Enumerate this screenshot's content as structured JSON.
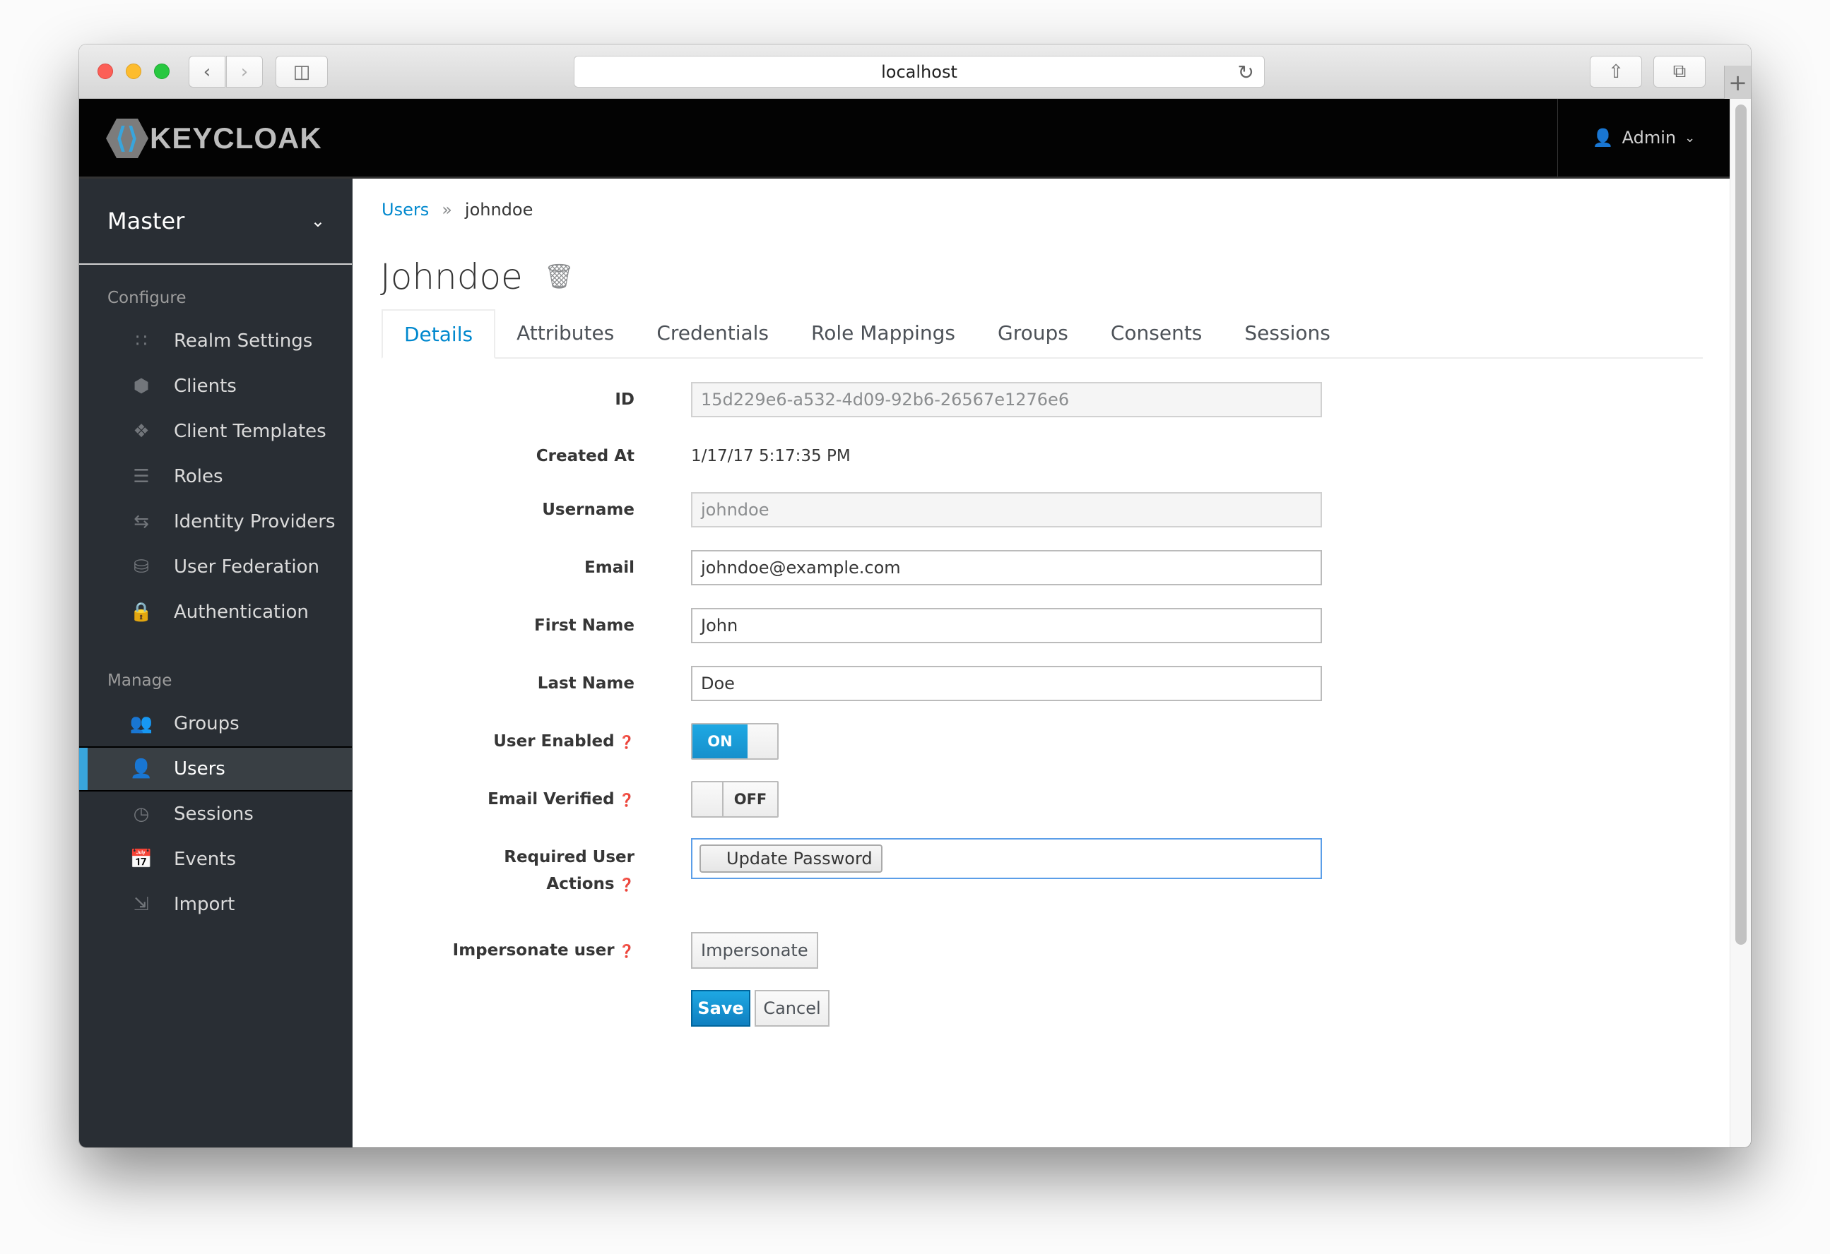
{
  "browser": {
    "url": "localhost",
    "back_icon": "chevron-left-icon",
    "forward_icon": "chevron-right-icon",
    "sidebar_icon": "sidebar-toggle-icon",
    "reload_icon": "reload-icon",
    "share_icon": "share-icon",
    "tabs_icon": "tab-overview-icon",
    "new_tab_label": "+"
  },
  "header": {
    "brand": "KEYCLOAK",
    "user_label": "Admin",
    "user_icon": "user-icon",
    "dropdown_icon": "chevron-down-icon"
  },
  "sidebar": {
    "realm": "Master",
    "sections": [
      {
        "title": "Configure",
        "items": [
          {
            "label": "Realm Settings",
            "icon": "sliders-icon",
            "active": false
          },
          {
            "label": "Clients",
            "icon": "cube-icon",
            "active": false
          },
          {
            "label": "Client Templates",
            "icon": "cubes-icon",
            "active": false
          },
          {
            "label": "Roles",
            "icon": "server-icon",
            "active": false
          },
          {
            "label": "Identity Providers",
            "icon": "exchange-icon",
            "active": false
          },
          {
            "label": "User Federation",
            "icon": "database-icon",
            "active": false
          },
          {
            "label": "Authentication",
            "icon": "lock-icon",
            "active": false
          }
        ]
      },
      {
        "title": "Manage",
        "items": [
          {
            "label": "Groups",
            "icon": "users-icon",
            "active": false
          },
          {
            "label": "Users",
            "icon": "user-icon",
            "active": true
          },
          {
            "label": "Sessions",
            "icon": "clock-icon",
            "active": false
          },
          {
            "label": "Events",
            "icon": "calendar-icon",
            "active": false
          },
          {
            "label": "Import",
            "icon": "import-icon",
            "active": false
          }
        ]
      }
    ]
  },
  "breadcrumb": {
    "parent": "Users",
    "separator": "»",
    "current": "johndoe"
  },
  "page": {
    "title": "Johndoe",
    "delete_icon": "trash-icon"
  },
  "tabs": [
    {
      "label": "Details",
      "active": true
    },
    {
      "label": "Attributes",
      "active": false
    },
    {
      "label": "Credentials",
      "active": false
    },
    {
      "label": "Role Mappings",
      "active": false
    },
    {
      "label": "Groups",
      "active": false
    },
    {
      "label": "Consents",
      "active": false
    },
    {
      "label": "Sessions",
      "active": false
    }
  ],
  "form": {
    "id": {
      "label": "ID",
      "value": "15d229e6-a532-4d09-92b6-26567e1276e6"
    },
    "created_at": {
      "label": "Created At",
      "value": "1/17/17 5:17:35 PM"
    },
    "username": {
      "label": "Username",
      "value": "johndoe"
    },
    "email": {
      "label": "Email",
      "value": "johndoe@example.com"
    },
    "first_name": {
      "label": "First Name",
      "value": "John"
    },
    "last_name": {
      "label": "Last Name",
      "value": "Doe"
    },
    "user_enabled": {
      "label": "User Enabled",
      "state": "ON",
      "on": true
    },
    "email_verified": {
      "label": "Email Verified",
      "state": "OFF",
      "on": false
    },
    "required_actions": {
      "label_line1": "Required User",
      "label_line2": "Actions",
      "selected": [
        "Update Password"
      ]
    },
    "impersonate": {
      "label": "Impersonate user",
      "button": "Impersonate"
    },
    "help_icon": "question-circle-icon"
  },
  "actions": {
    "save": "Save",
    "cancel": "Cancel"
  },
  "colors": {
    "accent": "#39a5dc",
    "link": "#0088ce",
    "primary_button": "#0f7fc0",
    "sidebar_bg": "#292e34",
    "header_bg": "#030303"
  }
}
